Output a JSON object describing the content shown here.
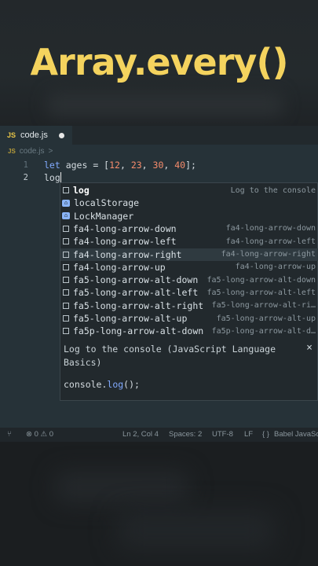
{
  "title": "Array.every()",
  "tab": {
    "badge": "JS",
    "name": "code.js"
  },
  "breadcrumb": {
    "badge": "JS",
    "name": "code.js",
    "chevron": ">"
  },
  "code": {
    "line1": {
      "num": "1",
      "kw": "let",
      "ident": " ages = [",
      "n1": "12",
      "c1": ", ",
      "n2": "23",
      "c2": ", ",
      "n3": "30",
      "c3": ", ",
      "n4": "40",
      "end": "];"
    },
    "line2": {
      "num": "2",
      "text": "log"
    }
  },
  "suggestions": [
    {
      "label_bold": "log",
      "label_rest": "",
      "detail": "Log to the console",
      "icon": "snippet"
    },
    {
      "label_bold": "",
      "label_rest": "localStorage",
      "detail": "",
      "icon": "symbol"
    },
    {
      "label_bold": "",
      "label_rest": "LockManager",
      "detail": "",
      "icon": "symbol"
    },
    {
      "label_bold": "",
      "label_rest": "fa4-long-arrow-down",
      "detail": "fa4-long-arrow-down",
      "icon": "snippet"
    },
    {
      "label_bold": "",
      "label_rest": "fa4-long-arrow-left",
      "detail": "fa4-long-arrow-left",
      "icon": "snippet"
    },
    {
      "label_bold": "",
      "label_rest": "fa4-long-arrow-right",
      "detail": "fa4-long-arrow-right",
      "icon": "snippet"
    },
    {
      "label_bold": "",
      "label_rest": "fa4-long-arrow-up",
      "detail": "fa4-long-arrow-up",
      "icon": "snippet"
    },
    {
      "label_bold": "",
      "label_rest": "fa5-long-arrow-alt-down",
      "detail": "fa5-long-arrow-alt-down",
      "icon": "snippet"
    },
    {
      "label_bold": "",
      "label_rest": "fa5-long-arrow-alt-left",
      "detail": "fa5-long-arrow-alt-left",
      "icon": "snippet"
    },
    {
      "label_bold": "",
      "label_rest": "fa5-long-arrow-alt-right",
      "detail": "fa5-long-arrow-alt-ri…",
      "icon": "snippet"
    },
    {
      "label_bold": "",
      "label_rest": "fa5-long-arrow-alt-up",
      "detail": "fa5-long-arrow-alt-up",
      "icon": "snippet"
    },
    {
      "label_bold": "",
      "label_rest": "fa5p-long-arrow-alt-down",
      "detail": "fa5p-long-arrow-alt-d…",
      "icon": "snippet"
    }
  ],
  "docs": {
    "text": "Log to the console (JavaScript Language Basics)",
    "close": "×",
    "code_obj": "console.",
    "code_fn": "log",
    "code_end": "();"
  },
  "status": {
    "errors": "0",
    "warnings": "0",
    "position": "Ln 2, Col 4",
    "spaces": "Spaces: 2",
    "encoding": "UTF-8",
    "eol": "LF",
    "braces": "{ }",
    "language": "Babel JavaScript"
  }
}
